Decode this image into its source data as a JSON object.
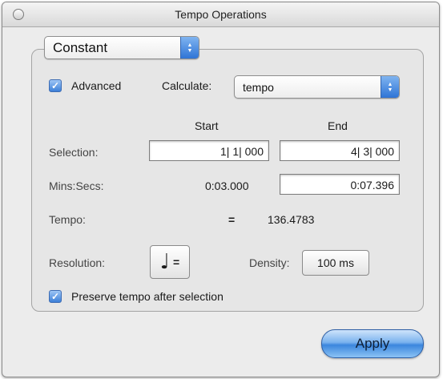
{
  "window": {
    "title": "Tempo Operations"
  },
  "mode": {
    "selected": "Constant"
  },
  "advanced": {
    "label": "Advanced",
    "checked": true
  },
  "calculate": {
    "label": "Calculate:",
    "selected": "tempo"
  },
  "columns": {
    "start": "Start",
    "end": "End"
  },
  "selection": {
    "label": "Selection:",
    "start": "1| 1| 000",
    "end": "4| 3| 000"
  },
  "mins_secs": {
    "label": "Mins:Secs:",
    "start": "0:03.000",
    "end": "0:07.396"
  },
  "tempo": {
    "label": "Tempo:",
    "equals": "=",
    "value": "136.4783"
  },
  "resolution": {
    "label": "Resolution:",
    "note_glyph": "♩",
    "equals": "="
  },
  "density": {
    "label": "Density:",
    "value": "100 ms"
  },
  "preserve": {
    "label": "Preserve tempo after selection",
    "checked": true
  },
  "apply": {
    "label": "Apply"
  },
  "icons": {
    "checkbox": "checkmark-icon",
    "popup": "up-down-arrows-icon",
    "note": "quarter-note-icon"
  }
}
